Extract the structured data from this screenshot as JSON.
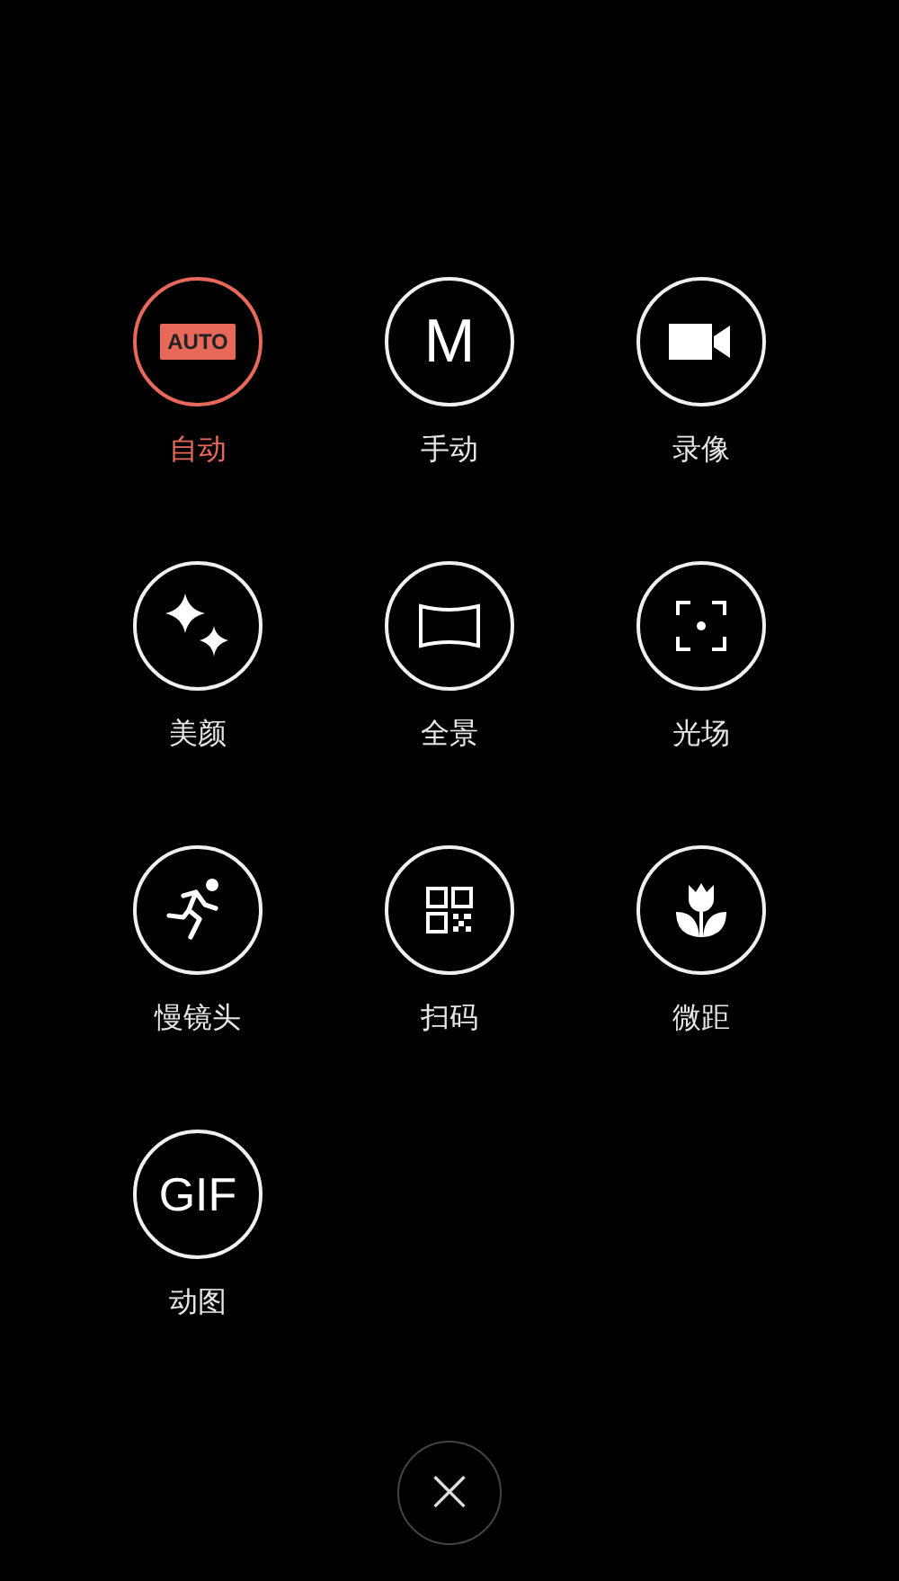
{
  "modes": [
    {
      "kind": "auto",
      "icon_text": "AUTO",
      "label": "自动",
      "selected": true
    },
    {
      "kind": "manual",
      "icon_text": "M",
      "label": "手动",
      "selected": false
    },
    {
      "kind": "video",
      "label": "录像",
      "selected": false
    },
    {
      "kind": "beauty",
      "label": "美颜",
      "selected": false
    },
    {
      "kind": "panorama",
      "label": "全景",
      "selected": false
    },
    {
      "kind": "lightfield",
      "label": "光场",
      "selected": false
    },
    {
      "kind": "slowmo",
      "label": "慢镜头",
      "selected": false
    },
    {
      "kind": "scan",
      "label": "扫码",
      "selected": false
    },
    {
      "kind": "macro",
      "label": "微距",
      "selected": false
    },
    {
      "kind": "gif",
      "icon_text": "GIF",
      "label": "动图",
      "selected": false
    }
  ],
  "close_button": {
    "symbol": "×"
  }
}
